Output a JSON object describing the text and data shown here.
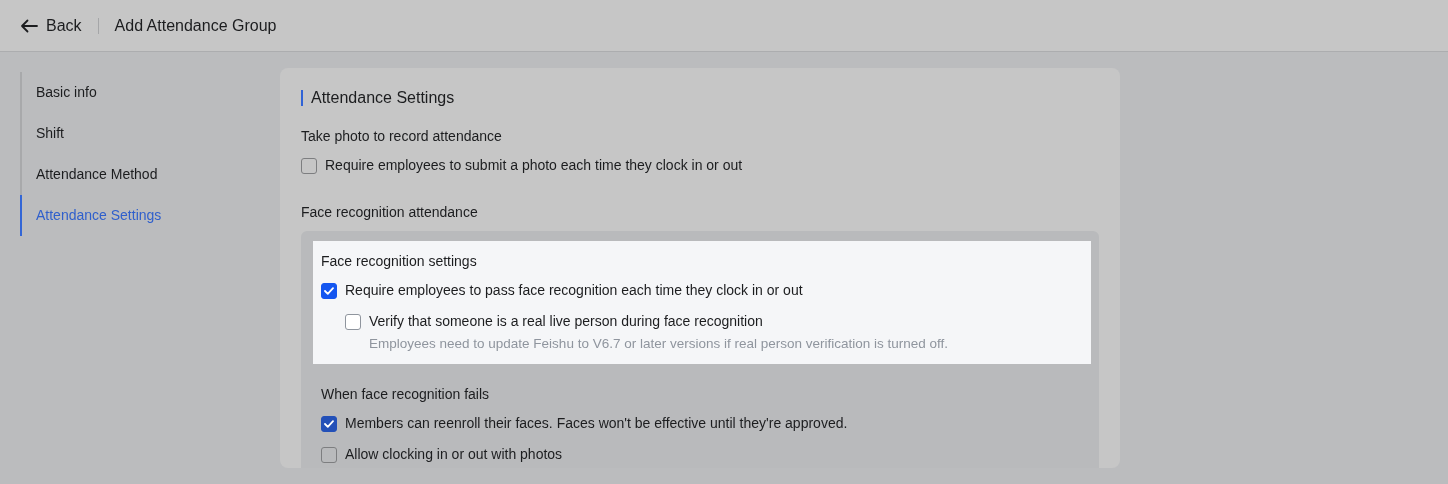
{
  "header": {
    "back": "Back",
    "title": "Add Attendance Group"
  },
  "sidebar": {
    "items": [
      {
        "label": "Basic info",
        "selected": false
      },
      {
        "label": "Shift",
        "selected": false
      },
      {
        "label": "Attendance Method",
        "selected": false
      },
      {
        "label": "Attendance Settings",
        "selected": true
      }
    ]
  },
  "section_title": "Attendance Settings",
  "photo": {
    "heading": "Take photo to record attendance",
    "options": [
      {
        "label": "Require employees to submit a photo each time they clock in or out",
        "checked": false
      }
    ]
  },
  "face": {
    "heading": "Face recognition attendance",
    "groups": [
      {
        "heading": "Face recognition settings",
        "highlighted": true,
        "options": [
          {
            "label": "Require employees to pass face recognition each time they clock in or out",
            "checked": true,
            "children": [
              {
                "label": "Verify that someone is a real live person during face recognition",
                "checked": false,
                "hint": "Employees need to update Feishu to V6.7 or later versions if real person verification is turned off."
              }
            ]
          }
        ]
      },
      {
        "heading": "When face recognition fails",
        "highlighted": false,
        "options": [
          {
            "label": "Members can reenroll their faces. Faces won't be effective until they're approved.",
            "checked": true
          },
          {
            "label": "Allow clocking in or out with photos",
            "checked": false
          }
        ]
      }
    ]
  }
}
